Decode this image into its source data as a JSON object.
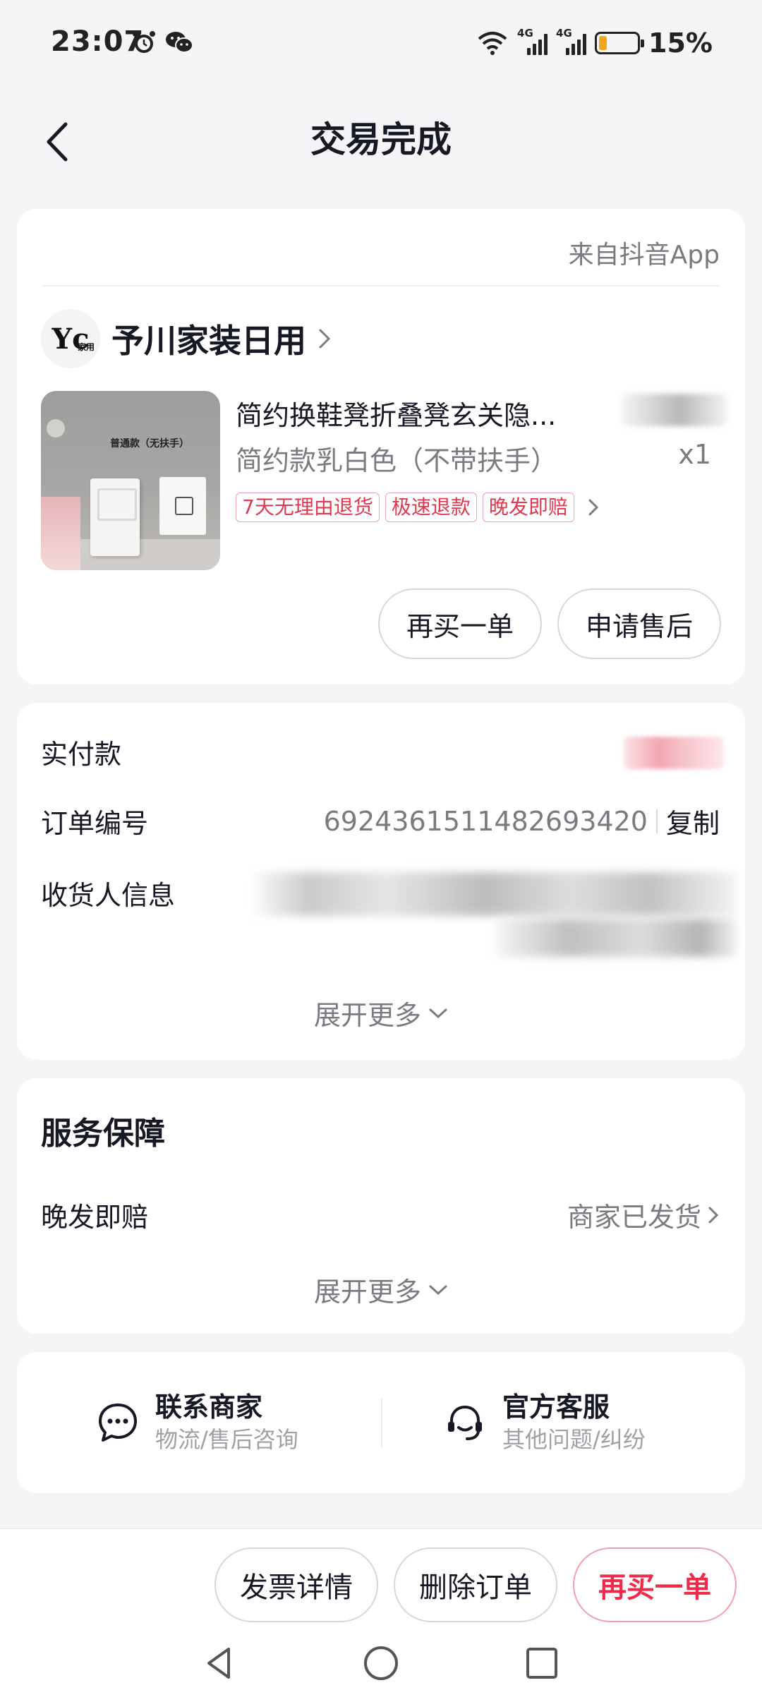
{
  "status_bar": {
    "time": "23:07",
    "battery_percent": "15%",
    "battery_level": 0.15,
    "network_1": "4G",
    "network_2": "4G"
  },
  "header": {
    "title": "交易完成"
  },
  "order_card": {
    "source": "来自抖音App",
    "shop_name": "予川家装日用",
    "shop_logo_text": "Yc",
    "shop_logo_small": "家用",
    "product": {
      "image_label": "普通款（无扶手）",
      "title": "简约换鞋凳折叠凳玄关隐...",
      "spec": "简约款乳白色（不带扶手）",
      "quantity": "x1"
    },
    "tags": [
      "7天无理由退货",
      "极速退款",
      "晚发即赔"
    ],
    "buttons": {
      "rebuy": "再买一单",
      "after_sale": "申请售后"
    }
  },
  "payment_card": {
    "paid_label": "实付款",
    "order_number_label": "订单编号",
    "order_number": "6924361511482693420",
    "copy_label": "复制",
    "receiver_label": "收货人信息",
    "expand_more": "展开更多"
  },
  "service_card": {
    "title": "服务保障",
    "item_label": "晚发即赔",
    "item_value": "商家已发货",
    "expand_more": "展开更多"
  },
  "contact_card": {
    "merchant": {
      "title": "联系商家",
      "subtitle": "物流/售后咨询"
    },
    "official": {
      "title": "官方客服",
      "subtitle": "其他问题/纠纷"
    }
  },
  "bottom_bar": {
    "invoice": "发票详情",
    "delete": "删除订单",
    "rebuy": "再买一单"
  },
  "colors": {
    "accent": "#ee2c4a",
    "tag_border": "#f0a3ad",
    "background": "#f5f5f7",
    "battery": "#f0a91e"
  }
}
